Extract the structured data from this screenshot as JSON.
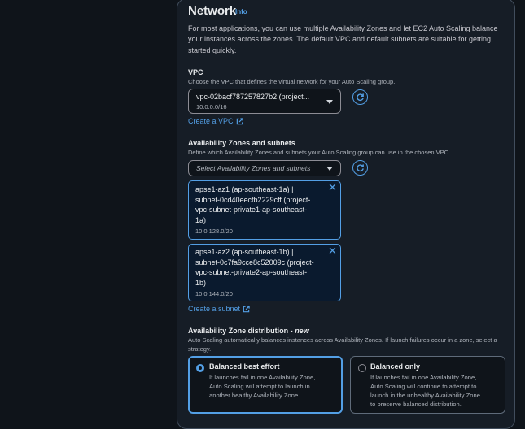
{
  "network": {
    "title": "Network",
    "info": "Info",
    "description": "For most applications, you can use multiple Availability Zones and let EC2 Auto Scaling balance your instances across the zones. The default VPC and default subnets are suitable for getting started quickly."
  },
  "vpc": {
    "label": "VPC",
    "sublabel": "Choose the VPC that defines the virtual network for your Auto Scaling group.",
    "selected": "vpc-02bacf787257827b2 (project...",
    "cidr": "10.0.0.0/16",
    "create_link": "Create a VPC"
  },
  "azs": {
    "label": "Availability Zones and subnets",
    "sublabel": "Define which Availability Zones and subnets your Auto Scaling group can use in the chosen VPC.",
    "placeholder": "Select Availability Zones and subnets",
    "tokens": [
      {
        "lines": [
          "apse1-az1 (ap-southeast-1a) |",
          "subnet-0cd40eecfb2229cff (project-",
          "vpc-subnet-private1-ap-southeast-",
          "1a)"
        ],
        "cidr": "10.0.128.0/20"
      },
      {
        "lines": [
          "apse1-az2 (ap-southeast-1b) |",
          "subnet-0c7fa9cce8c52009c (project-",
          "vpc-subnet-private2-ap-southeast-",
          "1b)"
        ],
        "cidr": "10.0.144.0/20"
      }
    ],
    "create_link": "Create a subnet"
  },
  "distribution": {
    "label": "Availability Zone distribution - ",
    "label_new": "new",
    "sublabel": "Auto Scaling automatically balances instances across Availability Zones. If launch failures occur in a zone, select a strategy.",
    "options": [
      {
        "title": "Balanced best effort",
        "desc": [
          "If launches fail in one Availability Zone,",
          "Auto Scaling will attempt to launch in",
          "another healthy Availability Zone."
        ],
        "selected": true
      },
      {
        "title": "Balanced only",
        "desc": [
          "If launches fail in one Availability Zone,",
          "Auto Scaling will continue to attempt to",
          "launch in the unhealthy Availability Zone",
          "to preserve balanced distribution."
        ],
        "selected": false
      }
    ]
  },
  "colors": {
    "accent": "#539fe5",
    "panel": "#161d26",
    "background": "#0f141a",
    "border": "#414d5c"
  },
  "icons": [
    "refresh-icon",
    "external-link-icon",
    "chevron-down-icon",
    "close-icon",
    "radio-icon"
  ]
}
